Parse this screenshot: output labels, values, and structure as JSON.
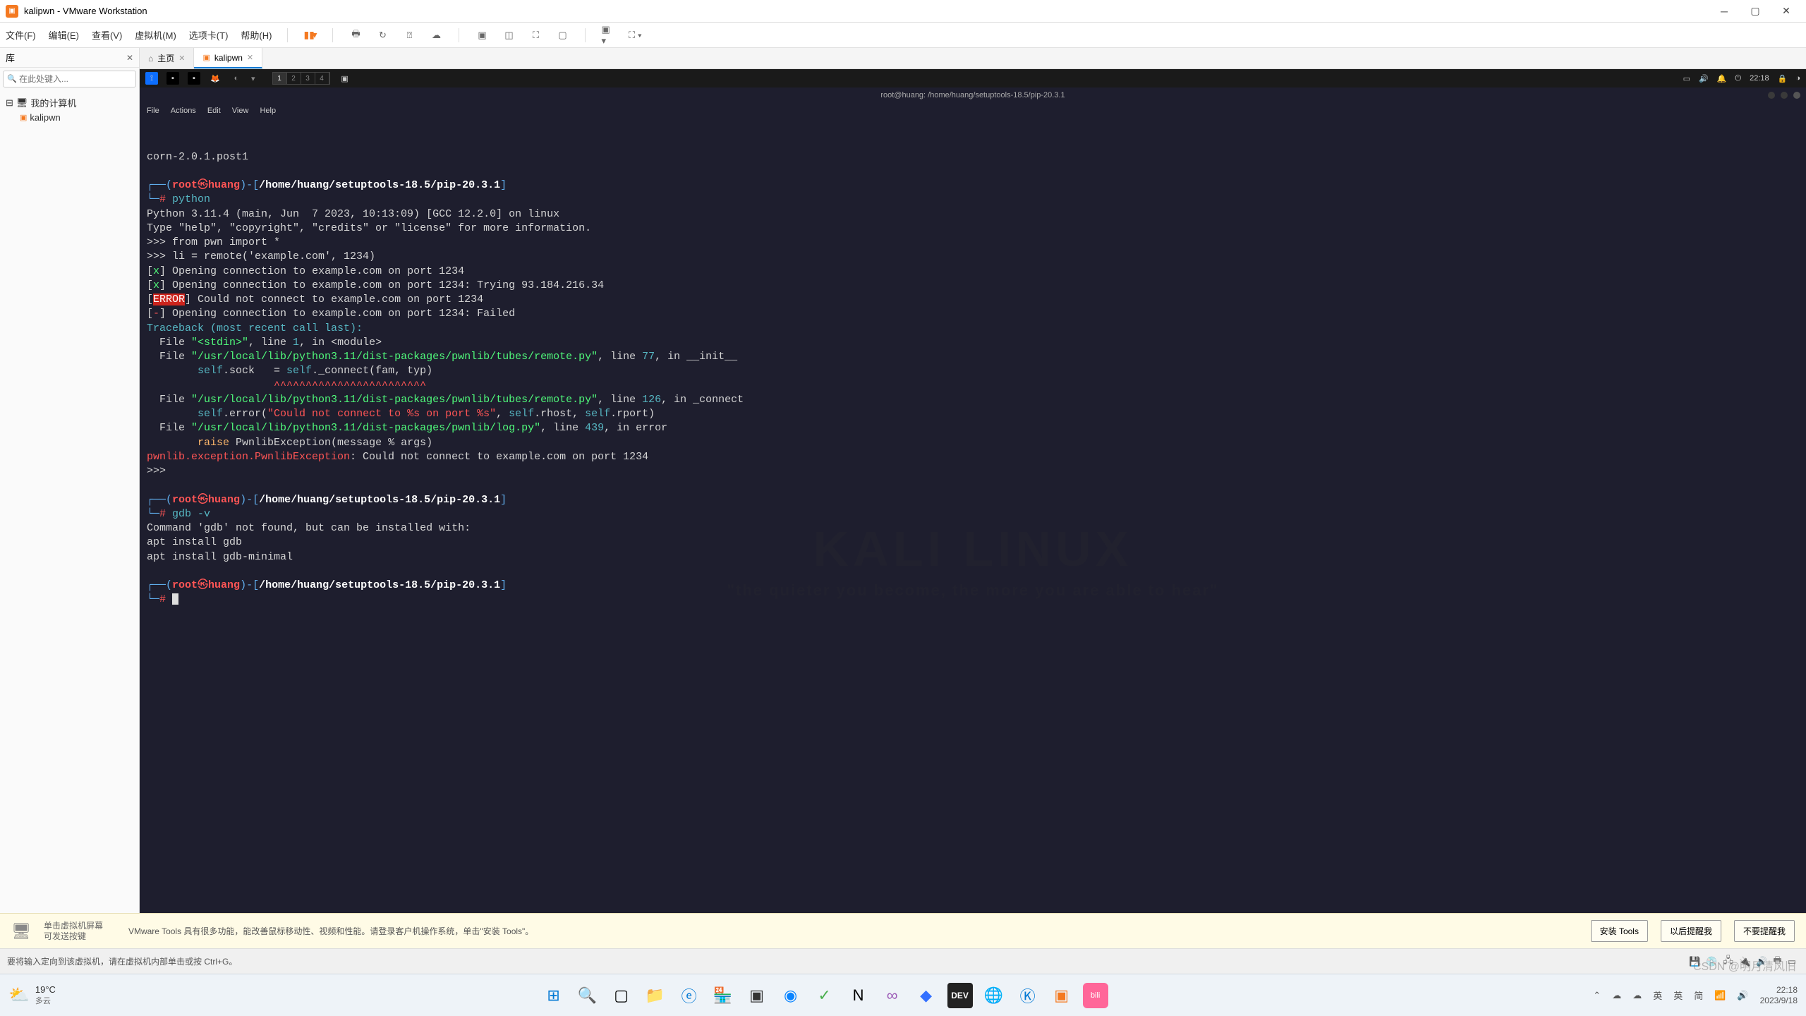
{
  "window": {
    "title": "kalipwn - VMware Workstation"
  },
  "menubar": {
    "file": "文件(F)",
    "edit": "编辑(E)",
    "view": "查看(V)",
    "vm": "虚拟机(M)",
    "tabs": "选项卡(T)",
    "help": "帮助(H)"
  },
  "sidebar": {
    "header": "库",
    "search_placeholder": "在此处键入...",
    "root": "我的计算机",
    "child": "kalipwn"
  },
  "tabs": {
    "home": "主页",
    "vm": "kalipwn"
  },
  "kali": {
    "workspaces": [
      "1",
      "2",
      "3",
      "4"
    ],
    "time": "22:18",
    "term_title": "root@huang: /home/huang/setuptools-18.5/pip-20.3.1",
    "menu": {
      "file": "File",
      "actions": "Actions",
      "edit": "Edit",
      "view": "View",
      "help": "Help"
    }
  },
  "terminal": {
    "line_corn": "corn-2.0.1.post1",
    "prompt_open": "┌──(",
    "prompt_user": "root",
    "prompt_at": "㉿",
    "prompt_host": "huang",
    "prompt_close_pre": ")-[",
    "prompt_path": "/home/huang/setuptools-18.5/pip-20.3.1",
    "prompt_close": "]",
    "prompt_l2": "└─",
    "prompt_hash": "#",
    "cmd_python": " python",
    "py_ver": "Python 3.11.4 (main, Jun  7 2023, 10:13:09) [GCC 12.2.0] on linux",
    "py_help": "Type \"help\", \"copyright\", \"credits\" or \"license\" for more information.",
    "py1": ">>> from pwn import *",
    "py2": ">>> li = remote('example.com', 1234)",
    "open1_pre": "[",
    "open_x": "x",
    "open1_post": "] Opening connection to example.com on port 1234",
    "open2_post": "] Opening connection to example.com on port 1234: Trying 93.184.216.34",
    "err_pre": "[",
    "err_lbl": "ERROR",
    "err_post": "] Could not connect to example.com on port 1234",
    "open3_pre": "[",
    "open3_dash": "-",
    "open3_post": "] Opening connection to example.com on port 1234: Failed",
    "tb_head": "Traceback (most recent call last):",
    "tb1_a": "  File ",
    "tb1_file": "\"<stdin>\"",
    "tb1_b": ", line ",
    "tb1_ln": "1",
    "tb1_c": ", in <module>",
    "tb2_a": "  File ",
    "tb2_file": "\"/usr/local/lib/python3.11/dist-packages/pwnlib/tubes/remote.py\"",
    "tb2_b": ", line ",
    "tb2_ln": "77",
    "tb2_c": ", in __init__",
    "tb2_code_a": "        self",
    "tb2_code_b": ".sock   = ",
    "tb2_code_c": "self",
    "tb2_code_d": "._connect(fam, typ)",
    "tb2_caret": "                    ^^^^^^^^^^^^^^^^^^^^^^^^",
    "tb3_a": "  File ",
    "tb3_file": "\"/usr/local/lib/python3.11/dist-packages/pwnlib/tubes/remote.py\"",
    "tb3_b": ", line ",
    "tb3_ln": "126",
    "tb3_c": ", in _connect",
    "tb3_code_a": "        self",
    "tb3_code_b": ".error(",
    "tb3_str": "\"Could not connect to %s on port %s\"",
    "tb3_code_c": ", ",
    "tb3_code_d": "self",
    "tb3_code_e": ".rhost, ",
    "tb3_code_f": "self",
    "tb3_code_g": ".rport)",
    "tb4_a": "  File ",
    "tb4_file": "\"/usr/local/lib/python3.11/dist-packages/pwnlib/log.py\"",
    "tb4_b": ", line ",
    "tb4_ln": "439",
    "tb4_c": ", in error",
    "tb4_code_a": "        raise",
    "tb4_code_b": " PwnlibException(message % args)",
    "exc_a": "pwnlib.exception.PwnlibException",
    "exc_b": ": Could not connect to example.com on port 1234",
    "py_prompt": ">>> ",
    "cmd_gdb": " gdb -v",
    "gdb1": "Command 'gdb' not found, but can be installed with:",
    "gdb2": "apt install gdb",
    "gdb3": "apt install gdb-minimal"
  },
  "hint": {
    "line1": "单击虚拟机屏幕",
    "line2": "可发送按键",
    "msg": "VMware Tools 具有很多功能，能改善鼠标移动性、视频和性能。请登录客户机操作系统，单击\"安装 Tools\"。",
    "btn1": "安装 Tools",
    "btn2": "以后提醒我",
    "btn3": "不要提醒我"
  },
  "status": {
    "msg": "要将输入定向到该虚拟机，请在虚拟机内部单击或按 Ctrl+G。"
  },
  "taskbar": {
    "temp": "19°C",
    "weather": "多云",
    "ime1": "英",
    "ime2": "英",
    "ime3": "简",
    "time": "22:18",
    "date": "2023/9/18"
  },
  "watermark": "CSDN @明月清风旧"
}
